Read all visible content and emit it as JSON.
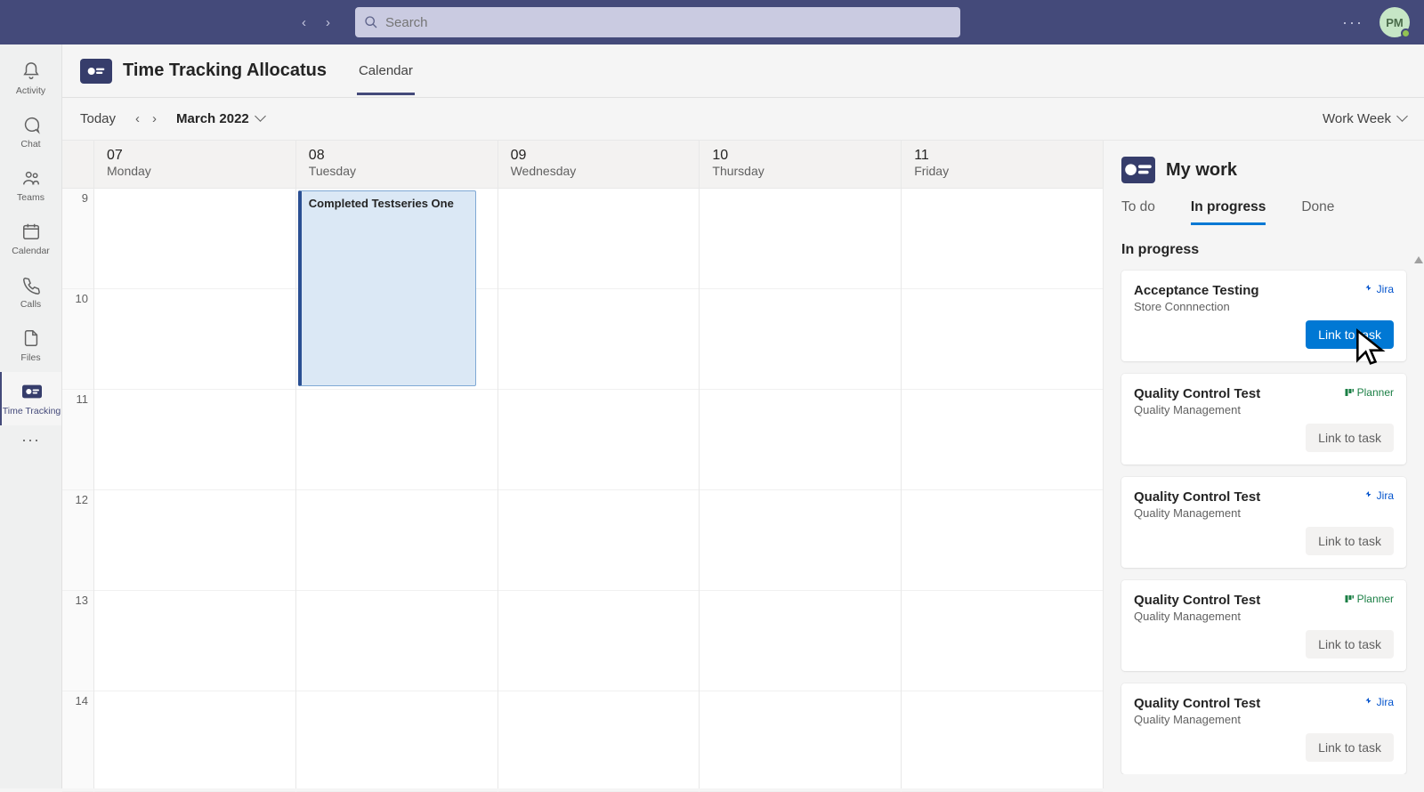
{
  "topbar": {
    "search_placeholder": "Search",
    "avatar_initials": "PM"
  },
  "rail": {
    "items": [
      {
        "id": "activity",
        "label": "Activity"
      },
      {
        "id": "chat",
        "label": "Chat"
      },
      {
        "id": "teams",
        "label": "Teams"
      },
      {
        "id": "calendar",
        "label": "Calendar"
      },
      {
        "id": "calls",
        "label": "Calls"
      },
      {
        "id": "files",
        "label": "Files"
      },
      {
        "id": "timetracking",
        "label": "Time Tracking"
      }
    ]
  },
  "app_header": {
    "title": "Time Tracking Allocatus",
    "tabs": [
      {
        "id": "calendar",
        "label": "Calendar",
        "active": true
      }
    ]
  },
  "cal_toolbar": {
    "today": "Today",
    "month": "March 2022",
    "view": "Work Week"
  },
  "calendar": {
    "hours": [
      "9",
      "10",
      "11",
      "12",
      "13",
      "14"
    ],
    "days": [
      {
        "num": "07",
        "name": "Monday"
      },
      {
        "num": "08",
        "name": "Tuesday"
      },
      {
        "num": "09",
        "name": "Wednesday"
      },
      {
        "num": "10",
        "name": "Thursday"
      },
      {
        "num": "11",
        "name": "Friday"
      }
    ],
    "events": [
      {
        "day_index": 1,
        "start_hour_index": 0,
        "span_hours": 2,
        "title": "Completed Testseries One"
      }
    ]
  },
  "side": {
    "title": "My work",
    "tabs": [
      {
        "id": "todo",
        "label": "To do"
      },
      {
        "id": "inprogress",
        "label": "In progress",
        "active": true
      },
      {
        "id": "done",
        "label": "Done"
      }
    ],
    "section_title": "In progress",
    "link_btn_label": "Link to task",
    "tasks": [
      {
        "title": "Acceptance Testing",
        "sub": "Store Connnection",
        "source": "Jira",
        "primary": true
      },
      {
        "title": "Quality Control Test",
        "sub": "Quality Management",
        "source": "Planner",
        "primary": false
      },
      {
        "title": "Quality Control Test",
        "sub": "Quality Management",
        "source": "Jira",
        "primary": false
      },
      {
        "title": "Quality Control Test",
        "sub": "Quality Management",
        "source": "Planner",
        "primary": false
      },
      {
        "title": "Quality Control Test",
        "sub": "Quality Management",
        "source": "Jira",
        "primary": false
      }
    ]
  }
}
